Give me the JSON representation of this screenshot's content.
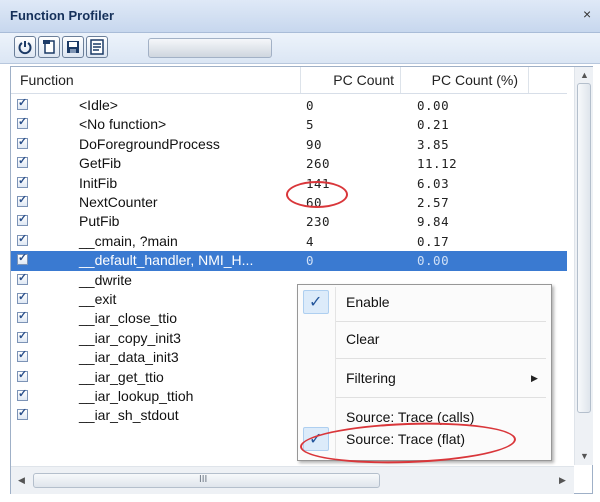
{
  "window": {
    "title": "Function Profiler",
    "close_glyph": "×"
  },
  "toolbar": {
    "buttons": [
      {
        "name": "power-button",
        "icon": "power-icon"
      },
      {
        "name": "new-window-button",
        "icon": "new-window-icon"
      },
      {
        "name": "save-button",
        "icon": "save-icon"
      },
      {
        "name": "view-button",
        "icon": "view-icon"
      }
    ]
  },
  "table": {
    "columns": [
      "Function",
      "PC Count",
      "PC Count (%)"
    ],
    "rows": [
      {
        "name": "<Idle>",
        "pc": "0",
        "pct": "0.00"
      },
      {
        "name": "<No function>",
        "pc": "5",
        "pct": "0.21"
      },
      {
        "name": "DoForegroundProcess",
        "pc": "90",
        "pct": "3.85"
      },
      {
        "name": "GetFib",
        "pc": "260",
        "pct": "11.12"
      },
      {
        "name": "InitFib",
        "pc": "141",
        "pct": "6.03"
      },
      {
        "name": "NextCounter",
        "pc": "60",
        "pct": "2.57"
      },
      {
        "name": "PutFib",
        "pc": "230",
        "pct": "9.84"
      },
      {
        "name": "__cmain, ?main",
        "pc": "4",
        "pct": "0.17"
      },
      {
        "name": "__default_handler, NMI_H...",
        "pc": "0",
        "pct": "0.00"
      },
      {
        "name": "__dwrite",
        "pc": "",
        "pct": ""
      },
      {
        "name": "__exit",
        "pc": "",
        "pct": ""
      },
      {
        "name": "__iar_close_ttio",
        "pc": "",
        "pct": ""
      },
      {
        "name": "__iar_copy_init3",
        "pc": "",
        "pct": ""
      },
      {
        "name": "__iar_data_init3",
        "pc": "",
        "pct": ""
      },
      {
        "name": "__iar_get_ttio",
        "pc": "",
        "pct": ""
      },
      {
        "name": "__iar_lookup_ttioh",
        "pc": "",
        "pct": ""
      },
      {
        "name": "__iar_sh_stdout",
        "pc": "",
        "pct": ""
      }
    ],
    "selected_index": 8
  },
  "scrollbar": {
    "h_thumb_label": "III"
  },
  "context_menu": {
    "items": [
      {
        "label": "Enable",
        "checked": true
      },
      {
        "label": "Clear",
        "checked": false
      },
      {
        "label": "Filtering",
        "submenu": true
      },
      {
        "label": "Source: Trace (calls)",
        "checked": false
      },
      {
        "label": "Source: Trace (flat)",
        "checked": true
      }
    ],
    "check_glyph": "✓",
    "submenu_glyph": "▶"
  },
  "colors": {
    "selection": "#3a7ad1",
    "annotation": "#d9363a",
    "title_text": "#15305a"
  }
}
